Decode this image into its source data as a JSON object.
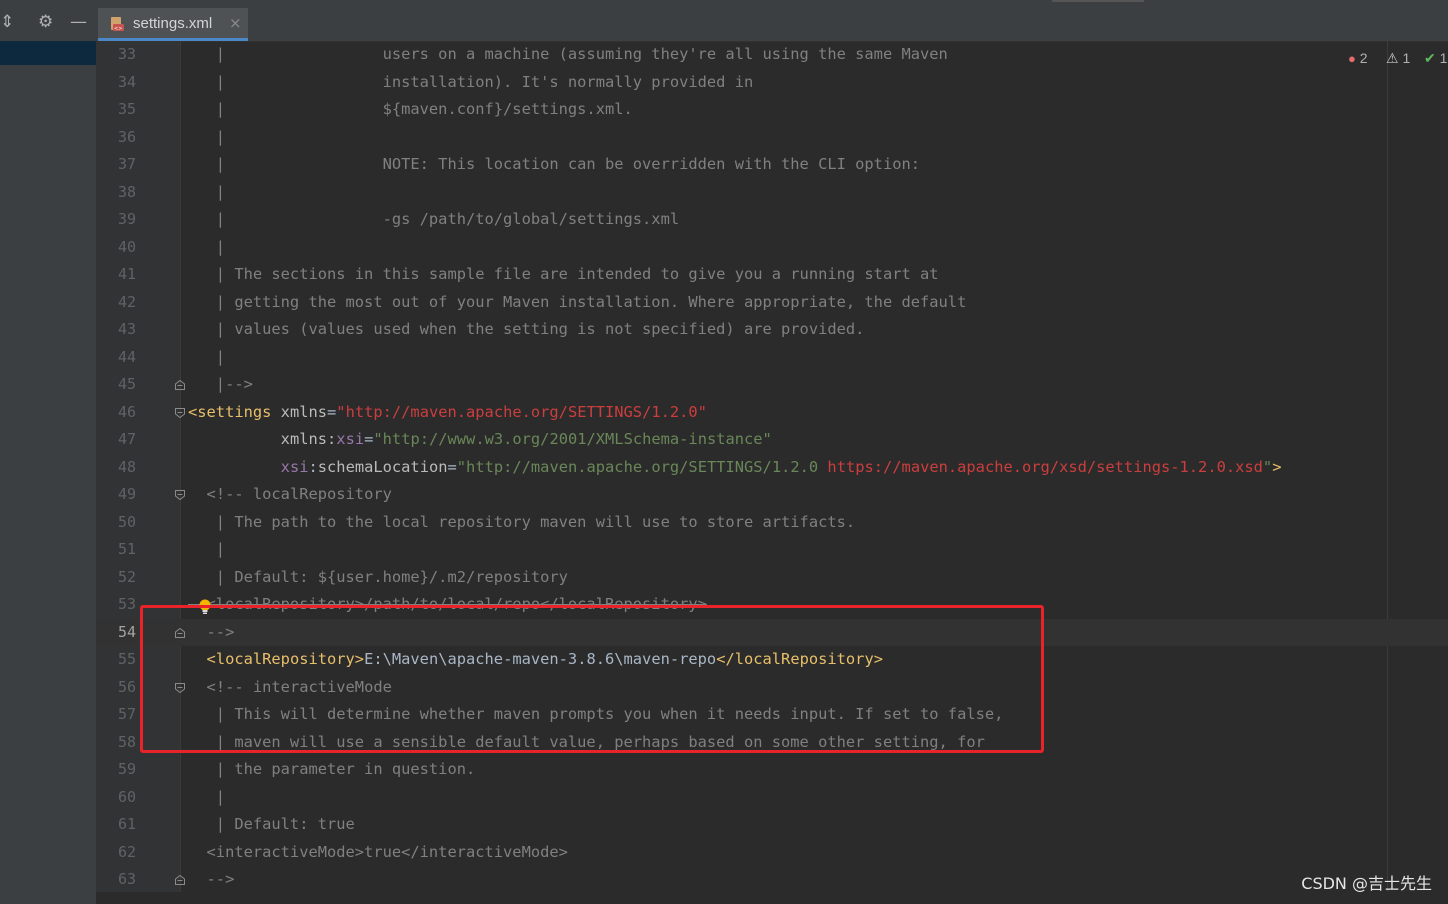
{
  "tab": {
    "label": "settings.xml",
    "close": "×"
  },
  "colors": {
    "accent": "#4a88c7",
    "highlight_box": "#e8242a"
  },
  "status": {
    "errors": "2",
    "warnings": "1",
    "ok": "1"
  },
  "watermark": "CSDN @吉士先生",
  "lines": [
    {
      "num": "33",
      "html": "<span class='c'>   |                 users on a machine (assuming they're all using the same Maven</span>"
    },
    {
      "num": "34",
      "html": "<span class='c'>   |                 installation). It's normally provided in</span>"
    },
    {
      "num": "35",
      "html": "<span class='c'>   |                 ${maven.conf}/settings.xml.</span>"
    },
    {
      "num": "36",
      "html": "<span class='c'>   |</span>"
    },
    {
      "num": "37",
      "html": "<span class='c'>   |                 NOTE: This location can be overridden with the CLI option:</span>"
    },
    {
      "num": "38",
      "html": "<span class='c'>   |</span>"
    },
    {
      "num": "39",
      "html": "<span class='c'>   |                 -gs /path/to/global/settings.xml</span>"
    },
    {
      "num": "40",
      "html": "<span class='c'>   |</span>"
    },
    {
      "num": "41",
      "html": "<span class='c'>   | The sections in this sample file are intended to give you a running start at</span>"
    },
    {
      "num": "42",
      "html": "<span class='c'>   | getting the most out of your Maven installation. Where appropriate, the default</span>"
    },
    {
      "num": "43",
      "html": "<span class='c'>   | values (values used when the setting is not specified) are provided.</span>"
    },
    {
      "num": "44",
      "html": "<span class='c'>   |</span>"
    },
    {
      "num": "45",
      "html": "<span class='c'>   |--></span>"
    },
    {
      "num": "46",
      "html": "<span class='tag'>&lt;settings </span><span class='attr'>xmlns</span><span class='txt'>=</span><span class='url'>\"http://maven.apache.org/SETTINGS/1.2.0\"</span>"
    },
    {
      "num": "47",
      "html": "          <span class='attr'>xmlns</span><span class='txt'>:</span><span class='ns'>xsi</span><span class='txt'>=</span><span class='val'>\"http://www.w3.org/2001/XMLSchema-instance\"</span>"
    },
    {
      "num": "48",
      "html": "          <span class='ns'>xsi</span><span class='txt'>:</span><span class='attr'>schemaLocation</span><span class='txt'>=</span><span class='val'>\"http://maven.apache.org/SETTINGS/1.2.0 </span><span class='url'>https://maven.apache.org/xsd/settings-1.2.0.xsd</span><span class='val'>\"</span><span class='tag'>&gt;</span>"
    },
    {
      "num": "49",
      "html": "  <span class='c'>&lt;!-- localRepository</span>"
    },
    {
      "num": "50",
      "html": "<span class='c'>   | The path to the local repository maven will use to store artifacts.</span>"
    },
    {
      "num": "51",
      "html": "<span class='c'>   |</span>"
    },
    {
      "num": "52",
      "html": "<span class='c'>   | Default: ${user.home}/.m2/repository</span>"
    },
    {
      "num": "53",
      "html": "<span class='c strike'>  &lt;localRepository&gt;/path/to/local/repo&lt;/localRepository&gt;</span>"
    },
    {
      "num": "54",
      "html": "<span class='c'>  --></span>"
    },
    {
      "num": "55",
      "html": "  <span class='tag'>&lt;localRepository&gt;</span><span class='txt'>E:\\Maven\\apache-maven-3.8.6\\maven-repo</span><span class='tag'>&lt;/localRepository&gt;</span>"
    },
    {
      "num": "56",
      "html": "  <span class='c'>&lt;!-- interactiveMode</span>"
    },
    {
      "num": "57",
      "html": "<span class='c'>   | This will determine whether maven prompts you when it needs input. If set to false,</span>"
    },
    {
      "num": "58",
      "html": "<span class='c'>   | maven will use a sensible default value, perhaps based on some other setting, for</span>"
    },
    {
      "num": "59",
      "html": "<span class='c'>   | the parameter in question.</span>"
    },
    {
      "num": "60",
      "html": "<span class='c'>   |</span>"
    },
    {
      "num": "61",
      "html": "<span class='c'>   | Default: true</span>"
    },
    {
      "num": "62",
      "html": "<span class='c'>  &lt;interactiveMode&gt;true&lt;/interactiveMode&gt;</span>"
    },
    {
      "num": "63",
      "html": "<span class='c'>  --></span>"
    }
  ]
}
